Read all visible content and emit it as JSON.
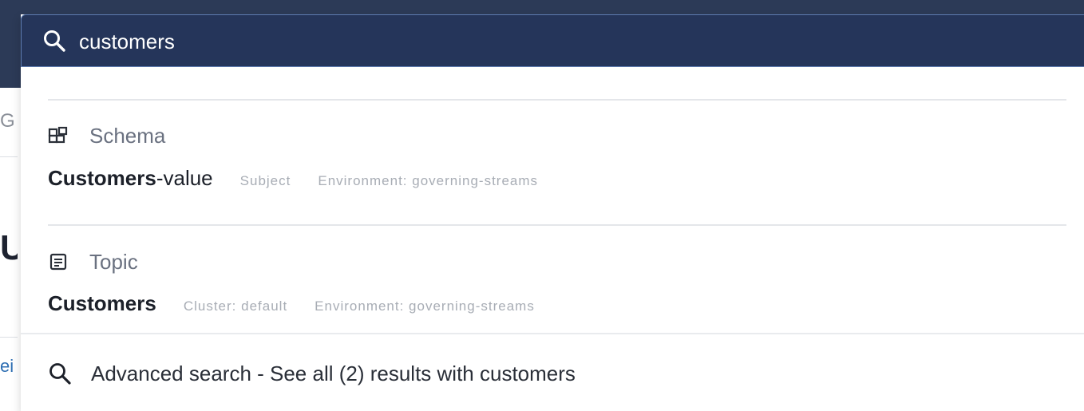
{
  "search": {
    "value": "customers",
    "icon": "search-icon"
  },
  "background_fragments": {
    "f1": "G",
    "f2": "U",
    "f3": "ei"
  },
  "sections": [
    {
      "title": "Schema",
      "icon": "schema-grid-icon",
      "results": [
        {
          "name_bold": "Customers",
          "name_rest": "-value",
          "meta": [
            "Subject",
            "Environment: governing-streams"
          ]
        }
      ]
    },
    {
      "title": "Topic",
      "icon": "topic-document-icon",
      "results": [
        {
          "name_bold": "Customers",
          "name_rest": "",
          "meta": [
            "Cluster: default",
            "Environment: governing-streams"
          ]
        }
      ]
    }
  ],
  "advanced_search": {
    "label": "Advanced search - See all (2) results with customers",
    "icon": "search-icon"
  },
  "colors": {
    "header_bg": "#25355a",
    "header_border": "#5e7bb0",
    "section_title": "#6a7180",
    "meta_text": "#a8adb5"
  }
}
